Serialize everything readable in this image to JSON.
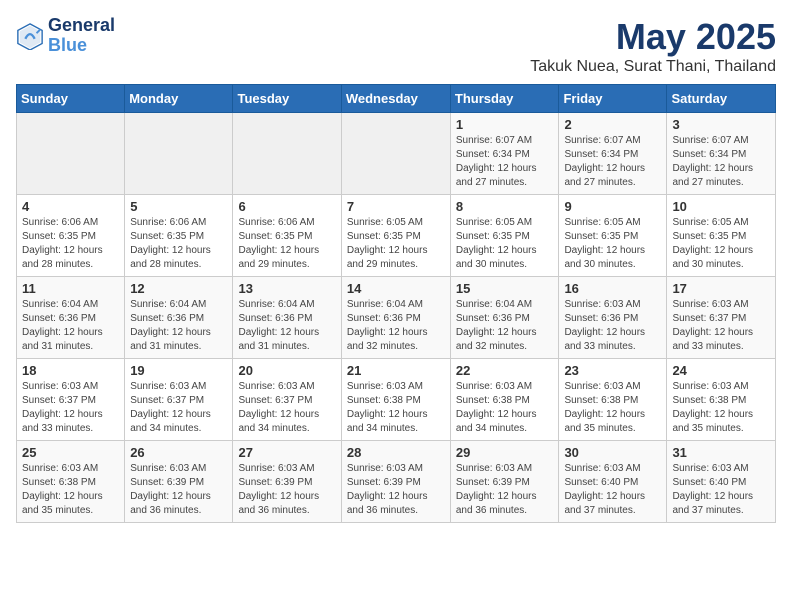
{
  "logo": {
    "line1": "General",
    "line2": "Blue"
  },
  "title": "May 2025",
  "location": "Takuk Nuea, Surat Thani, Thailand",
  "weekdays": [
    "Sunday",
    "Monday",
    "Tuesday",
    "Wednesday",
    "Thursday",
    "Friday",
    "Saturday"
  ],
  "weeks": [
    [
      {
        "day": "",
        "info": ""
      },
      {
        "day": "",
        "info": ""
      },
      {
        "day": "",
        "info": ""
      },
      {
        "day": "",
        "info": ""
      },
      {
        "day": "1",
        "info": "Sunrise: 6:07 AM\nSunset: 6:34 PM\nDaylight: 12 hours\nand 27 minutes."
      },
      {
        "day": "2",
        "info": "Sunrise: 6:07 AM\nSunset: 6:34 PM\nDaylight: 12 hours\nand 27 minutes."
      },
      {
        "day": "3",
        "info": "Sunrise: 6:07 AM\nSunset: 6:34 PM\nDaylight: 12 hours\nand 27 minutes."
      }
    ],
    [
      {
        "day": "4",
        "info": "Sunrise: 6:06 AM\nSunset: 6:35 PM\nDaylight: 12 hours\nand 28 minutes."
      },
      {
        "day": "5",
        "info": "Sunrise: 6:06 AM\nSunset: 6:35 PM\nDaylight: 12 hours\nand 28 minutes."
      },
      {
        "day": "6",
        "info": "Sunrise: 6:06 AM\nSunset: 6:35 PM\nDaylight: 12 hours\nand 29 minutes."
      },
      {
        "day": "7",
        "info": "Sunrise: 6:05 AM\nSunset: 6:35 PM\nDaylight: 12 hours\nand 29 minutes."
      },
      {
        "day": "8",
        "info": "Sunrise: 6:05 AM\nSunset: 6:35 PM\nDaylight: 12 hours\nand 30 minutes."
      },
      {
        "day": "9",
        "info": "Sunrise: 6:05 AM\nSunset: 6:35 PM\nDaylight: 12 hours\nand 30 minutes."
      },
      {
        "day": "10",
        "info": "Sunrise: 6:05 AM\nSunset: 6:35 PM\nDaylight: 12 hours\nand 30 minutes."
      }
    ],
    [
      {
        "day": "11",
        "info": "Sunrise: 6:04 AM\nSunset: 6:36 PM\nDaylight: 12 hours\nand 31 minutes."
      },
      {
        "day": "12",
        "info": "Sunrise: 6:04 AM\nSunset: 6:36 PM\nDaylight: 12 hours\nand 31 minutes."
      },
      {
        "day": "13",
        "info": "Sunrise: 6:04 AM\nSunset: 6:36 PM\nDaylight: 12 hours\nand 31 minutes."
      },
      {
        "day": "14",
        "info": "Sunrise: 6:04 AM\nSunset: 6:36 PM\nDaylight: 12 hours\nand 32 minutes."
      },
      {
        "day": "15",
        "info": "Sunrise: 6:04 AM\nSunset: 6:36 PM\nDaylight: 12 hours\nand 32 minutes."
      },
      {
        "day": "16",
        "info": "Sunrise: 6:03 AM\nSunset: 6:36 PM\nDaylight: 12 hours\nand 33 minutes."
      },
      {
        "day": "17",
        "info": "Sunrise: 6:03 AM\nSunset: 6:37 PM\nDaylight: 12 hours\nand 33 minutes."
      }
    ],
    [
      {
        "day": "18",
        "info": "Sunrise: 6:03 AM\nSunset: 6:37 PM\nDaylight: 12 hours\nand 33 minutes."
      },
      {
        "day": "19",
        "info": "Sunrise: 6:03 AM\nSunset: 6:37 PM\nDaylight: 12 hours\nand 34 minutes."
      },
      {
        "day": "20",
        "info": "Sunrise: 6:03 AM\nSunset: 6:37 PM\nDaylight: 12 hours\nand 34 minutes."
      },
      {
        "day": "21",
        "info": "Sunrise: 6:03 AM\nSunset: 6:38 PM\nDaylight: 12 hours\nand 34 minutes."
      },
      {
        "day": "22",
        "info": "Sunrise: 6:03 AM\nSunset: 6:38 PM\nDaylight: 12 hours\nand 34 minutes."
      },
      {
        "day": "23",
        "info": "Sunrise: 6:03 AM\nSunset: 6:38 PM\nDaylight: 12 hours\nand 35 minutes."
      },
      {
        "day": "24",
        "info": "Sunrise: 6:03 AM\nSunset: 6:38 PM\nDaylight: 12 hours\nand 35 minutes."
      }
    ],
    [
      {
        "day": "25",
        "info": "Sunrise: 6:03 AM\nSunset: 6:38 PM\nDaylight: 12 hours\nand 35 minutes."
      },
      {
        "day": "26",
        "info": "Sunrise: 6:03 AM\nSunset: 6:39 PM\nDaylight: 12 hours\nand 36 minutes."
      },
      {
        "day": "27",
        "info": "Sunrise: 6:03 AM\nSunset: 6:39 PM\nDaylight: 12 hours\nand 36 minutes."
      },
      {
        "day": "28",
        "info": "Sunrise: 6:03 AM\nSunset: 6:39 PM\nDaylight: 12 hours\nand 36 minutes."
      },
      {
        "day": "29",
        "info": "Sunrise: 6:03 AM\nSunset: 6:39 PM\nDaylight: 12 hours\nand 36 minutes."
      },
      {
        "day": "30",
        "info": "Sunrise: 6:03 AM\nSunset: 6:40 PM\nDaylight: 12 hours\nand 37 minutes."
      },
      {
        "day": "31",
        "info": "Sunrise: 6:03 AM\nSunset: 6:40 PM\nDaylight: 12 hours\nand 37 minutes."
      }
    ]
  ]
}
